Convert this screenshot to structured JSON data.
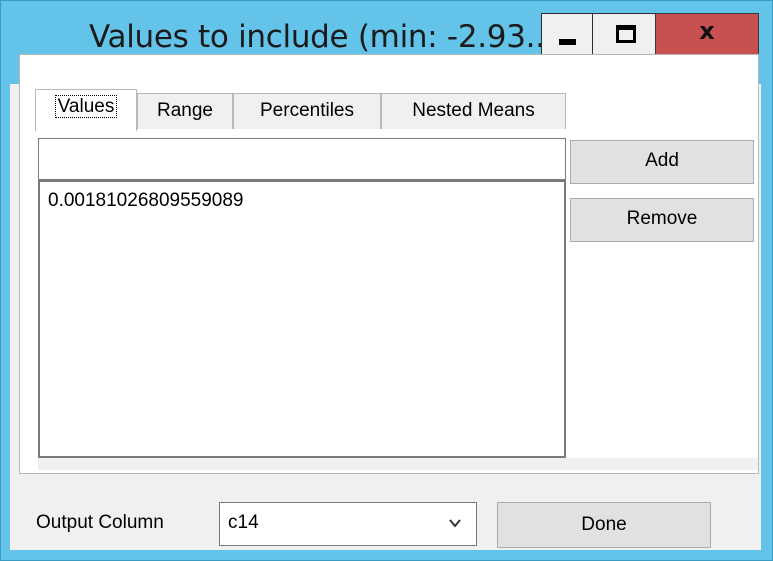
{
  "window": {
    "title": "Values to include (min: -2.93...",
    "minimize_icon": "minimize-icon",
    "maximize_icon": "maximize-icon",
    "close_icon": "close-icon",
    "close_glyph": "x"
  },
  "tabs": [
    {
      "label": "Values",
      "active": true
    },
    {
      "label": "Range",
      "active": false
    },
    {
      "label": "Percentiles",
      "active": false
    },
    {
      "label": "Nested Means",
      "active": false
    }
  ],
  "values_tab": {
    "input_value": "",
    "items": [
      "0.00181026809559089"
    ],
    "add_label": "Add",
    "remove_label": "Remove"
  },
  "footer": {
    "output_column_label": "Output Column",
    "output_column_value": "c14",
    "done_label": "Done"
  },
  "colors": {
    "titlebar": "#63c3e8",
    "close_button": "#c75050",
    "client_background": "#f0f0f0"
  }
}
